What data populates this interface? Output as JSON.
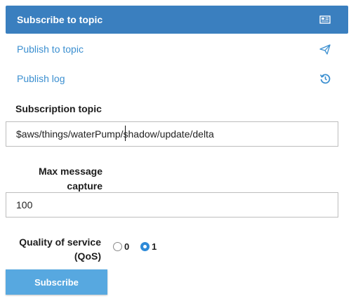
{
  "nav": {
    "items": [
      {
        "label": "Subscribe to topic",
        "icon": "newspaper-icon",
        "active": true
      },
      {
        "label": "Publish to topic",
        "icon": "paper-plane-icon",
        "active": false
      },
      {
        "label": "Publish log",
        "icon": "history-icon",
        "active": false
      }
    ]
  },
  "form": {
    "topic_label": "Subscription topic",
    "topic_value": "$aws/things/waterPump/shadow/update/delta",
    "max_label_line1": "Max message",
    "max_label_line2": "capture",
    "max_value": "100",
    "qos_label_line1": "Quality of service",
    "qos_label_line2": "(QoS)",
    "qos_options": [
      {
        "label": "0",
        "checked": false
      },
      {
        "label": "1",
        "checked": true
      }
    ],
    "subscribe_label": "Subscribe"
  },
  "colors": {
    "active_nav_bg": "#3a7fbf",
    "link": "#3b8fd0",
    "button_bg": "#57a8e0",
    "radio_checked": "#2e8ad8"
  }
}
